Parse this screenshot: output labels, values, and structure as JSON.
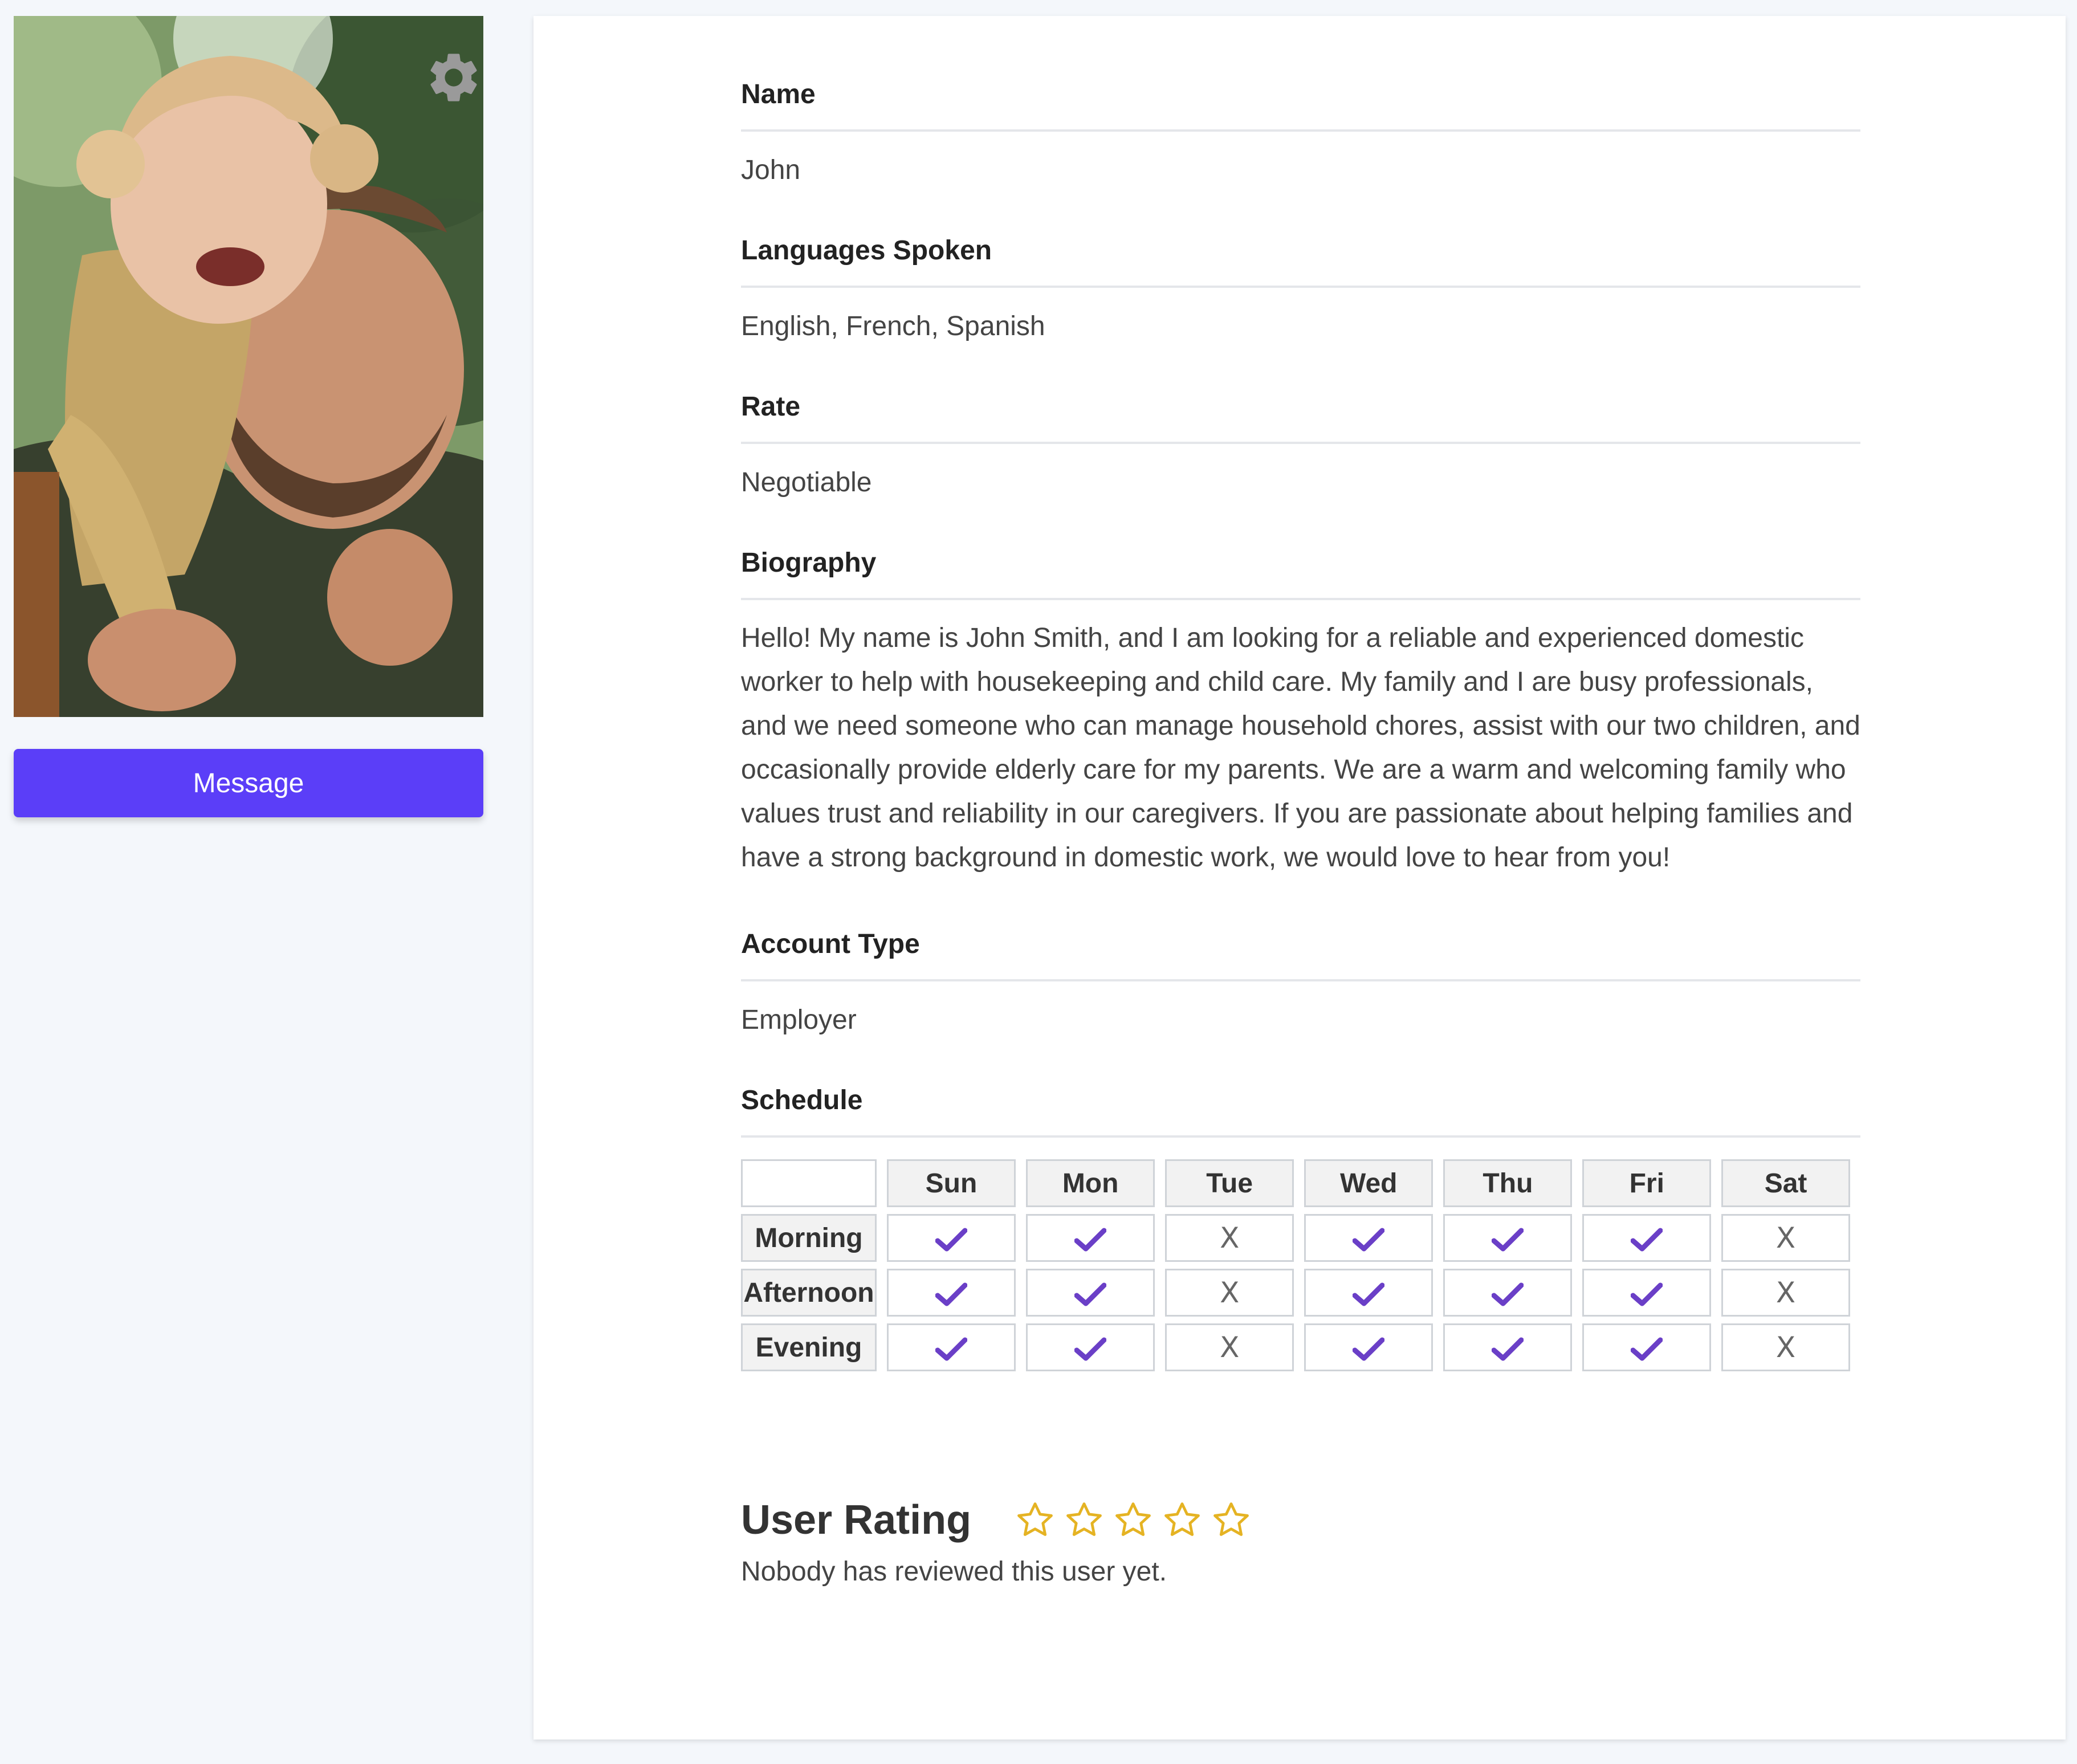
{
  "profile": {
    "photo_alt": "",
    "message_label": "Message",
    "icons": {
      "settings": "gear-icon",
      "available": "check-icon",
      "unavailable": "cross-icon",
      "rating": "star-icon"
    }
  },
  "fields": {
    "name_label": "Name",
    "name_value": "John",
    "languages_label": "Languages Spoken",
    "languages_value": "English, French, Spanish",
    "rate_label": "Rate",
    "rate_value": "Negotiable",
    "bio_label": "Biography",
    "bio_value": "Hello! My name is John Smith, and I am looking for a reliable and experienced domestic worker to help with housekeeping and child care. My family and I are busy professionals, and we need someone who can manage household chores, assist with our two children, and occasionally provide elderly care for my parents. We are a warm and welcoming family who values trust and reliability in our caregivers. If you are passionate about helping families and have a strong background in domestic work, we would love to hear from you!",
    "account_label": "Account Type",
    "account_value": "Employer",
    "schedule_label": "Schedule"
  },
  "schedule": {
    "days": [
      "Sun",
      "Mon",
      "Tue",
      "Wed",
      "Thu",
      "Fri",
      "Sat"
    ],
    "rows": [
      {
        "label": "Morning",
        "availability": [
          true,
          true,
          false,
          true,
          true,
          true,
          false
        ]
      },
      {
        "label": "Afternoon",
        "availability": [
          true,
          true,
          false,
          true,
          true,
          true,
          false
        ]
      },
      {
        "label": "Evening",
        "availability": [
          true,
          true,
          false,
          true,
          true,
          true,
          false
        ]
      }
    ],
    "cross_glyph": "X"
  },
  "rating": {
    "title": "User Rating",
    "stars_filled": 0,
    "stars_total": 5,
    "note": "Nobody has reviewed this user yet."
  },
  "colors": {
    "accent": "#5b3ef8",
    "check": "#6a3fc7",
    "star": "#e5b323"
  }
}
